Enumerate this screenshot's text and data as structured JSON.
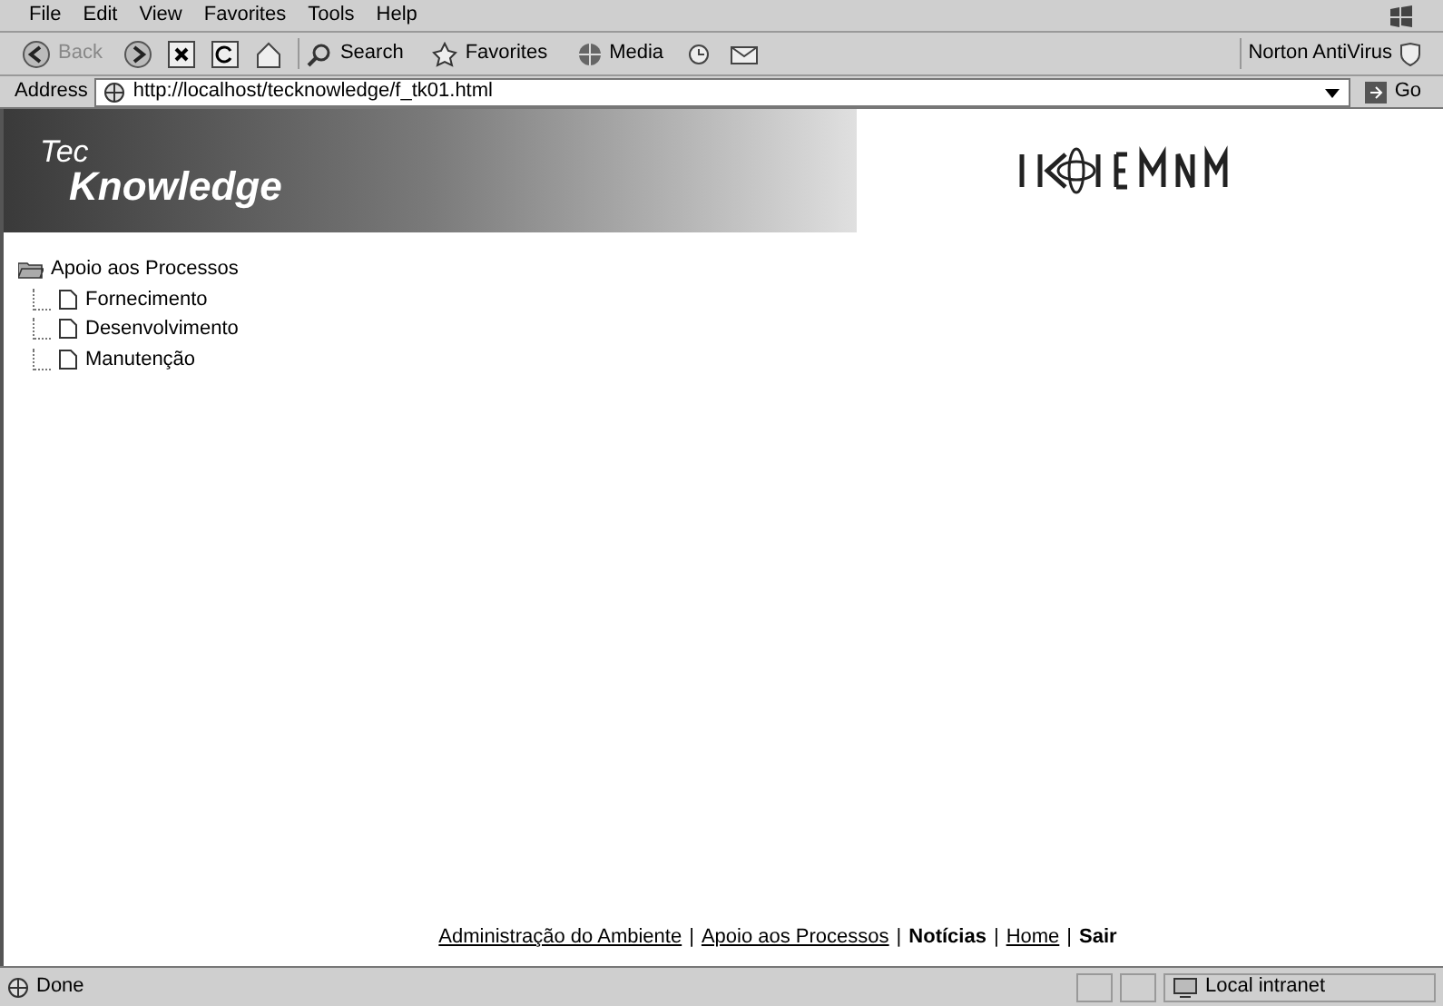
{
  "menu": [
    "File",
    "Edit",
    "View",
    "Favorites",
    "Tools",
    "Help"
  ],
  "toolbar": {
    "back": "Back",
    "search": "Search",
    "favorites": "Favorites",
    "media": "Media",
    "norton": "Norton AntiVirus"
  },
  "address": {
    "label": "Address",
    "url": "http://localhost/tecknowledge/f_tk01.html",
    "go": "Go"
  },
  "banner": {
    "title_top": "Tec",
    "title_bottom": "Knowledge"
  },
  "tree": {
    "label": "Apoio aos Processos",
    "expanded": true,
    "children": [
      {
        "label": "Fornecimento"
      },
      {
        "label": "Desenvolvimento"
      },
      {
        "label": "Manutenção"
      }
    ]
  },
  "footer_links": [
    {
      "label": "Administração do Ambiente",
      "underlined": true
    },
    {
      "label": "Apoio aos Processos",
      "underlined": true
    },
    {
      "label": "Notícias",
      "underlined": false
    },
    {
      "label": "Home",
      "underlined": true
    },
    {
      "label": "Sair",
      "underlined": false
    }
  ],
  "footer_separator": "|",
  "status_bar": {
    "text": "Done",
    "zone": "Local intranet"
  }
}
